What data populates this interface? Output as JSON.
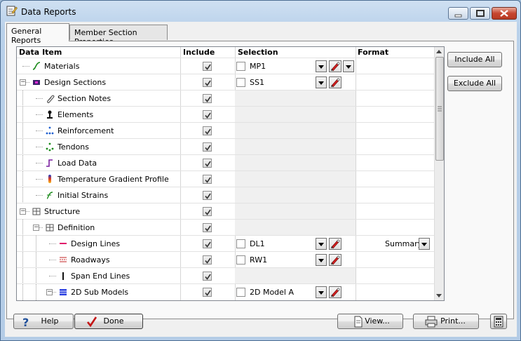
{
  "window": {
    "title": "Data Reports"
  },
  "tabs": [
    {
      "label": "General Reports",
      "active": true
    },
    {
      "label": "Member Section Properties",
      "active": false
    }
  ],
  "grid": {
    "columns": [
      "Data Item",
      "Include",
      "Selection",
      "Format"
    ],
    "rows": [
      {
        "label": "Materials",
        "icon": "material-curve-icon",
        "included": true,
        "selection_checked": false,
        "selection": "MP1",
        "format": ""
      },
      {
        "label": "Design Sections",
        "icon": "section-icon",
        "included": true,
        "selection_checked": false,
        "selection": "SS1",
        "format": ""
      },
      {
        "label": "Section Notes",
        "icon": "paperclip-icon",
        "included": true,
        "selection": "",
        "format": ""
      },
      {
        "label": "Elements",
        "icon": "element-icon",
        "included": true,
        "selection": "",
        "format": ""
      },
      {
        "label": "Reinforcement",
        "icon": "reinforcement-icon",
        "included": true,
        "selection": "",
        "format": ""
      },
      {
        "label": "Tendons",
        "icon": "tendon-icon",
        "included": true,
        "selection": "",
        "format": ""
      },
      {
        "label": "Load Data",
        "icon": "load-data-icon",
        "included": true,
        "selection": "",
        "format": ""
      },
      {
        "label": "Temperature Gradient Profile",
        "icon": "temperature-icon",
        "included": true,
        "selection": "",
        "format": ""
      },
      {
        "label": "Initial Strains",
        "icon": "strain-icon",
        "included": true,
        "selection": "",
        "format": ""
      },
      {
        "label": "Structure",
        "icon": "structure-icon",
        "included": true,
        "selection": "",
        "format": ""
      },
      {
        "label": "Definition",
        "icon": "definition-icon",
        "included": true,
        "selection": "",
        "format": ""
      },
      {
        "label": "Design Lines",
        "icon": "design-line-icon",
        "included": true,
        "selection_checked": false,
        "selection": "DL1",
        "format": "Summary"
      },
      {
        "label": "Roadways",
        "icon": "roadway-icon",
        "included": true,
        "selection_checked": false,
        "selection": "RW1",
        "format": ""
      },
      {
        "label": "Span End Lines",
        "icon": "span-end-line-icon",
        "included": true,
        "selection": "",
        "format": ""
      },
      {
        "label": "2D Sub Models",
        "icon": "sub-model-icon",
        "included": true,
        "selection_checked": false,
        "selection": "2D Model A",
        "format": ""
      }
    ]
  },
  "side_buttons": {
    "include_all": "Include All",
    "exclude_all": "Exclude All"
  },
  "footer": {
    "help": "Help",
    "done": "Done",
    "view": "View...",
    "print": "Print..."
  }
}
